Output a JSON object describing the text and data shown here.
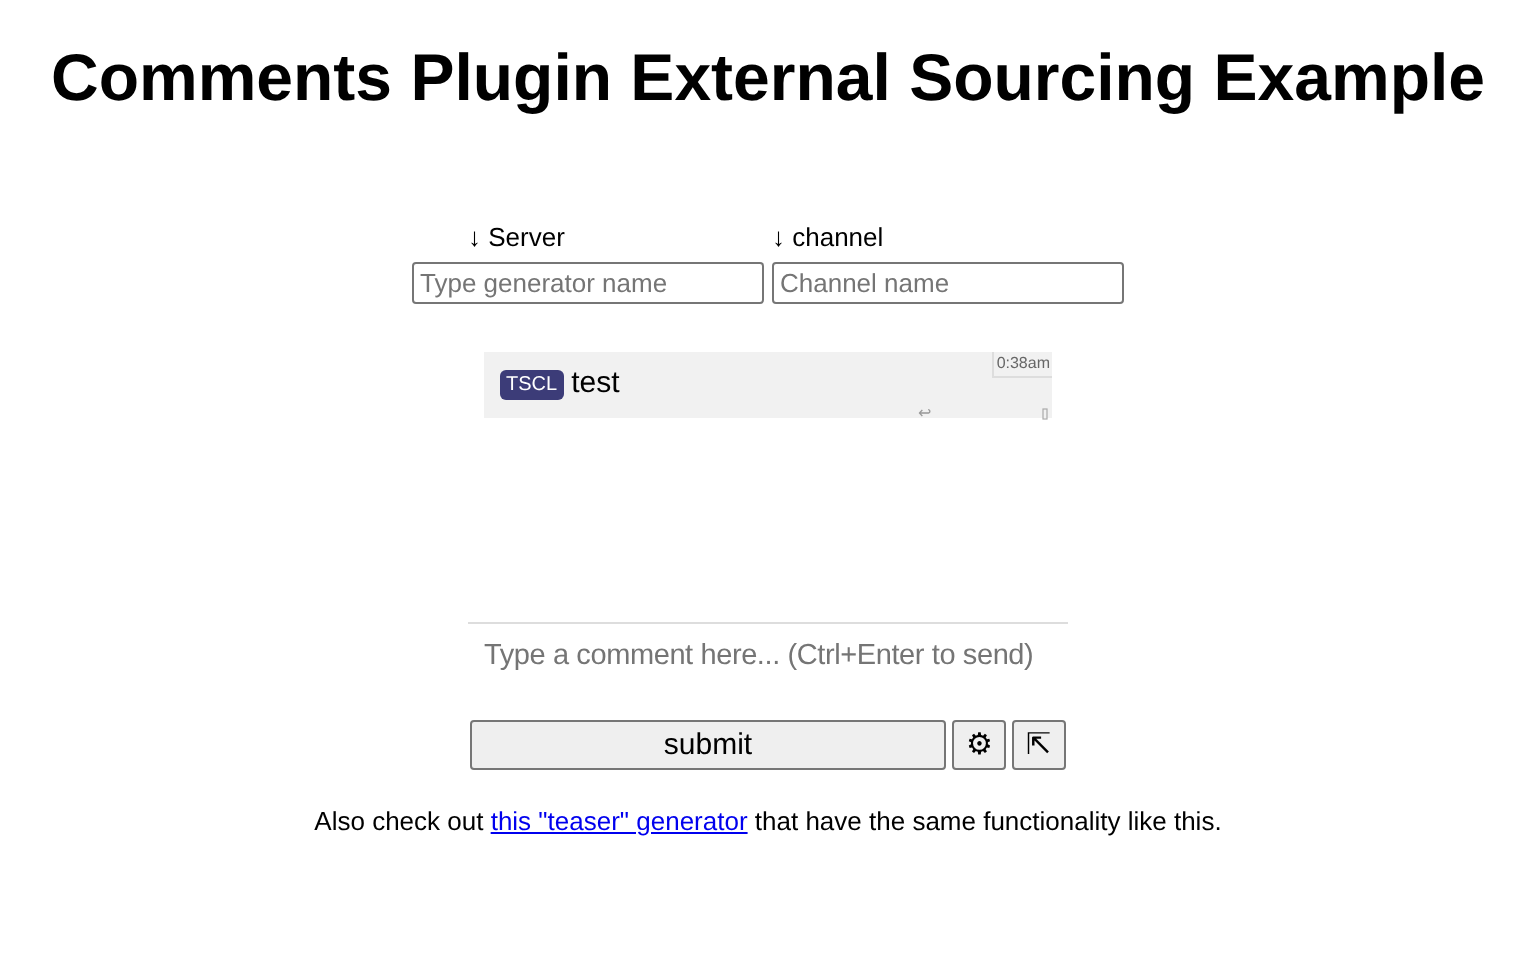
{
  "title": "Comments Plugin External Sourcing Example",
  "fields": [
    {
      "label": "↓ Server",
      "placeholder": "Type generator name"
    },
    {
      "label": "↓ channel",
      "placeholder": "Channel name"
    }
  ],
  "comments": [
    {
      "tag": "TSCL",
      "text": "test",
      "time": "0:38am",
      "reply": "↩"
    }
  ],
  "composer": {
    "placeholder": "Type a comment here... (Ctrl+Enter to send)"
  },
  "buttons": [
    {
      "label": "submit",
      "kind": "submit"
    },
    {
      "label": "⚙",
      "kind": "icon"
    },
    {
      "label": "⇱",
      "kind": "icon"
    }
  ],
  "footer": {
    "before": "Also check out ",
    "link": "this \"teaser\" generator",
    "after": " that have the same functionality like this."
  }
}
